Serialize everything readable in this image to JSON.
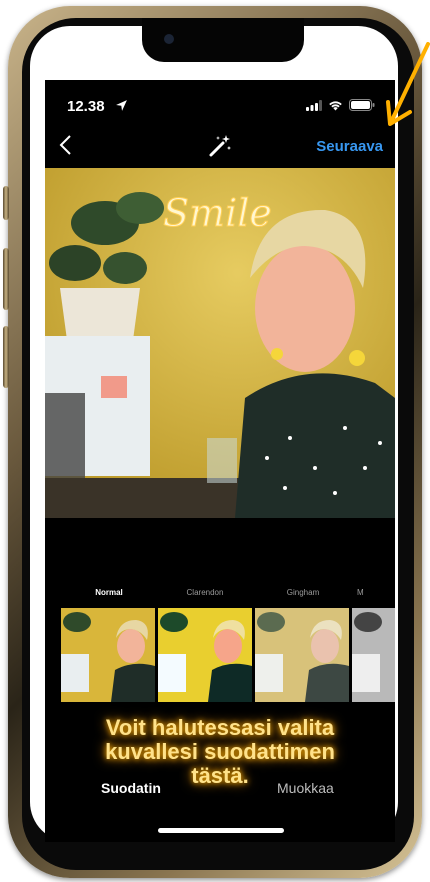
{
  "status_bar": {
    "time": "12.38"
  },
  "nav": {
    "next_label": "Seuraava"
  },
  "photo": {
    "sign_text": "Smile"
  },
  "filters": [
    {
      "label": "Normal",
      "active": true
    },
    {
      "label": "Clarendon",
      "active": false
    },
    {
      "label": "Gingham",
      "active": false
    },
    {
      "label": "M",
      "active": false
    }
  ],
  "caption": {
    "text": "Voit halutessasi valita\nkuvallesi suodattimen\ntästä."
  },
  "tabs": {
    "filter_label": "Suodatin",
    "edit_label": "Muokkaa"
  },
  "colors": {
    "accent": "#3897f0",
    "caption": "#ffe28a",
    "wall": "#d9b63a"
  }
}
